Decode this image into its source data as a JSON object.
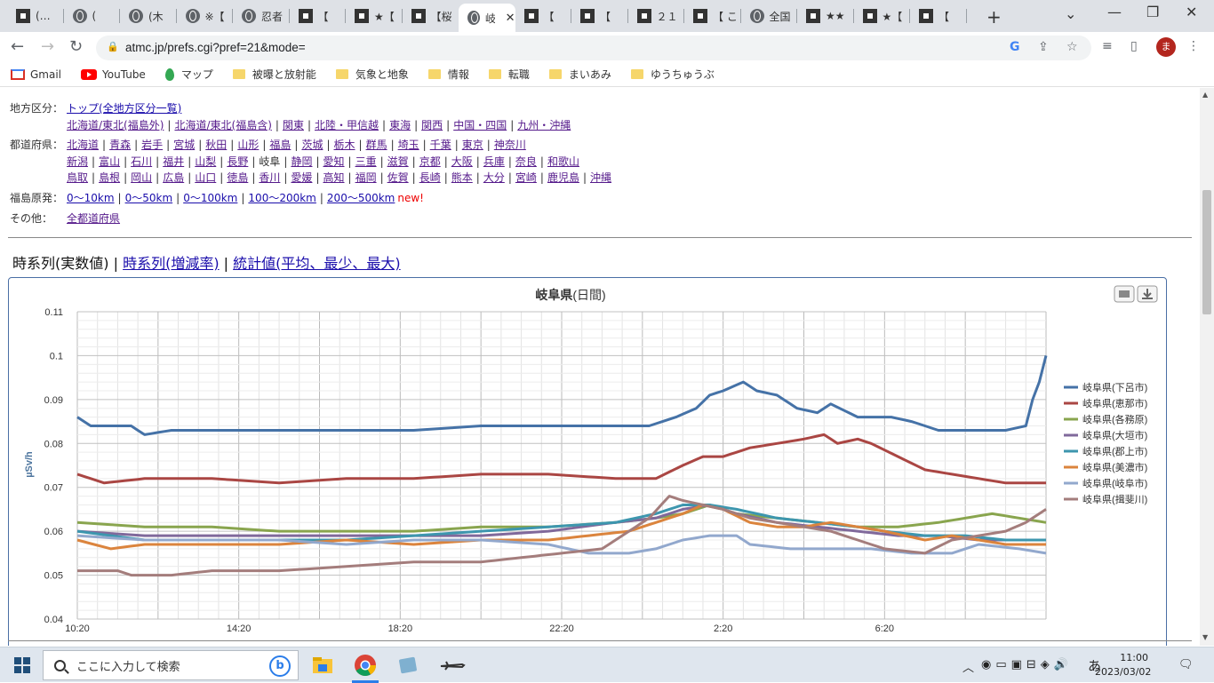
{
  "browser": {
    "tabs": [
      {
        "label": "(…",
        "icon": "dark"
      },
      {
        "label": "(",
        "icon": "globe"
      },
      {
        "label": "(木",
        "icon": "globe"
      },
      {
        "label": "※【",
        "icon": "globe"
      },
      {
        "label": "忍者",
        "icon": "globe"
      },
      {
        "label": "【 ",
        "icon": "dark"
      },
      {
        "label": "★【",
        "icon": "dark"
      },
      {
        "label": "【桜",
        "icon": "dark"
      },
      {
        "label": "岐",
        "icon": "globe",
        "active": true
      },
      {
        "label": "【",
        "icon": "dark"
      },
      {
        "label": "【",
        "icon": "dark"
      },
      {
        "label": "２１",
        "icon": "dark"
      },
      {
        "label": "【 こ",
        "icon": "dark"
      },
      {
        "label": "全国",
        "icon": "globe"
      },
      {
        "label": "★★",
        "icon": "dark"
      },
      {
        "label": "★【",
        "icon": "dark"
      },
      {
        "label": "【 ",
        "icon": "dark"
      }
    ],
    "url": "atmc.jp/prefs.cgi?pref=21&mode=",
    "avatar_letter": "ま",
    "bookmarks": [
      {
        "label": "Gmail",
        "icon": "gmail-icon"
      },
      {
        "label": "YouTube",
        "icon": "youtube-icon"
      },
      {
        "label": "マップ",
        "icon": "maps-icon"
      },
      {
        "label": "被曝と放射能",
        "icon": "folder-icon"
      },
      {
        "label": "気象と地象",
        "icon": "folder-icon"
      },
      {
        "label": "情報",
        "icon": "folder-icon"
      },
      {
        "label": "転職",
        "icon": "folder-icon"
      },
      {
        "label": "まいあみ",
        "icon": "folder-icon"
      },
      {
        "label": "ゆうちゅうぶ",
        "icon": "folder-icon"
      }
    ]
  },
  "nav": {
    "region_label": "地方区分：",
    "region_top": "トップ(全地方区分一覧)",
    "regions": [
      "北海道/東北(福島外)",
      "北海道/東北(福島含)",
      "関東",
      "北陸・甲信越",
      "東海",
      "関西",
      "中国・四国",
      "九州・沖縄"
    ],
    "pref_label": "都道府県：",
    "prefs_row1": [
      "北海道",
      "青森",
      "岩手",
      "宮城",
      "秋田",
      "山形",
      "福島",
      "茨城",
      "栃木",
      "群馬",
      "埼玉",
      "千葉",
      "東京",
      "神奈川"
    ],
    "prefs_row2": [
      "新潟",
      "富山",
      "石川",
      "福井",
      "山梨",
      "長野",
      "岐阜",
      "静岡",
      "愛知",
      "三重",
      "滋賀",
      "京都",
      "大阪",
      "兵庫",
      "奈良",
      "和歌山"
    ],
    "prefs_row3": [
      "鳥取",
      "島根",
      "岡山",
      "広島",
      "山口",
      "徳島",
      "香川",
      "愛媛",
      "高知",
      "福岡",
      "佐賀",
      "長崎",
      "熊本",
      "大分",
      "宮崎",
      "鹿児島",
      "沖縄"
    ],
    "current_pref": "岐阜",
    "fukushima_label": "福島原発：",
    "fukushima": [
      "0〜10km",
      "0〜50km",
      "0〜100km",
      "100〜200km",
      "200〜500km"
    ],
    "new_badge": "new!",
    "other_label": "その他：",
    "other_link": "全都道府県"
  },
  "modes": {
    "current": "時系列(実数値)",
    "link1": "時系列(増減率)",
    "link2": "統計値(平均、最少、最大)",
    "sep": "|"
  },
  "chart_data": {
    "type": "line",
    "title": "岐阜県",
    "subtitle": "(日間)",
    "ylabel": "µSv/h",
    "ylim": [
      0.04,
      0.11
    ],
    "yticks": [
      "0.04",
      "0.05",
      "0.06",
      "0.07",
      "0.08",
      "0.09",
      "0.1",
      "0.11"
    ],
    "xtick_labels": [
      "10:20",
      "14:20",
      "18:20",
      "22:20",
      "2:20",
      "6:20"
    ],
    "n_points": 145,
    "series": [
      {
        "name": "岐阜県(下呂市)",
        "color": "#4572a7",
        "knots": [
          [
            0,
            0.086
          ],
          [
            2,
            0.084
          ],
          [
            8,
            0.084
          ],
          [
            10,
            0.082
          ],
          [
            14,
            0.083
          ],
          [
            20,
            0.083
          ],
          [
            30,
            0.083
          ],
          [
            40,
            0.083
          ],
          [
            50,
            0.083
          ],
          [
            60,
            0.084
          ],
          [
            70,
            0.084
          ],
          [
            80,
            0.084
          ],
          [
            85,
            0.084
          ],
          [
            89,
            0.086
          ],
          [
            92,
            0.088
          ],
          [
            94,
            0.091
          ],
          [
            96,
            0.092
          ],
          [
            99,
            0.094
          ],
          [
            101,
            0.092
          ],
          [
            104,
            0.091
          ],
          [
            107,
            0.088
          ],
          [
            110,
            0.087
          ],
          [
            112,
            0.089
          ],
          [
            116,
            0.086
          ],
          [
            121,
            0.086
          ],
          [
            124,
            0.085
          ],
          [
            128,
            0.083
          ],
          [
            134,
            0.083
          ],
          [
            138,
            0.083
          ],
          [
            141,
            0.084
          ],
          [
            142,
            0.09
          ],
          [
            143,
            0.094
          ],
          [
            144,
            0.1
          ]
        ]
      },
      {
        "name": "岐阜県(恵那市)",
        "color": "#aa4643",
        "knots": [
          [
            0,
            0.073
          ],
          [
            4,
            0.071
          ],
          [
            10,
            0.072
          ],
          [
            20,
            0.072
          ],
          [
            30,
            0.071
          ],
          [
            40,
            0.072
          ],
          [
            50,
            0.072
          ],
          [
            60,
            0.073
          ],
          [
            70,
            0.073
          ],
          [
            80,
            0.072
          ],
          [
            86,
            0.072
          ],
          [
            90,
            0.075
          ],
          [
            93,
            0.077
          ],
          [
            96,
            0.077
          ],
          [
            100,
            0.079
          ],
          [
            104,
            0.08
          ],
          [
            108,
            0.081
          ],
          [
            111,
            0.082
          ],
          [
            113,
            0.08
          ],
          [
            116,
            0.081
          ],
          [
            118,
            0.08
          ],
          [
            122,
            0.077
          ],
          [
            126,
            0.074
          ],
          [
            130,
            0.073
          ],
          [
            134,
            0.072
          ],
          [
            138,
            0.071
          ],
          [
            141,
            0.071
          ],
          [
            144,
            0.071
          ]
        ]
      },
      {
        "name": "岐阜県(各務原)",
        "color": "#89a54e",
        "knots": [
          [
            0,
            0.062
          ],
          [
            10,
            0.061
          ],
          [
            20,
            0.061
          ],
          [
            30,
            0.06
          ],
          [
            40,
            0.06
          ],
          [
            50,
            0.06
          ],
          [
            60,
            0.061
          ],
          [
            70,
            0.061
          ],
          [
            80,
            0.062
          ],
          [
            86,
            0.063
          ],
          [
            90,
            0.064
          ],
          [
            94,
            0.066
          ],
          [
            98,
            0.064
          ],
          [
            104,
            0.063
          ],
          [
            110,
            0.062
          ],
          [
            116,
            0.061
          ],
          [
            122,
            0.061
          ],
          [
            128,
            0.062
          ],
          [
            132,
            0.063
          ],
          [
            136,
            0.064
          ],
          [
            140,
            0.063
          ],
          [
            144,
            0.062
          ]
        ]
      },
      {
        "name": "岐阜県(大垣市)",
        "color": "#80699b",
        "knots": [
          [
            0,
            0.06
          ],
          [
            10,
            0.059
          ],
          [
            20,
            0.059
          ],
          [
            30,
            0.059
          ],
          [
            40,
            0.059
          ],
          [
            50,
            0.059
          ],
          [
            60,
            0.059
          ],
          [
            70,
            0.06
          ],
          [
            80,
            0.062
          ],
          [
            86,
            0.063
          ],
          [
            90,
            0.065
          ],
          [
            94,
            0.066
          ],
          [
            98,
            0.064
          ],
          [
            104,
            0.062
          ],
          [
            110,
            0.061
          ],
          [
            116,
            0.06
          ],
          [
            122,
            0.059
          ],
          [
            128,
            0.059
          ],
          [
            134,
            0.058
          ],
          [
            140,
            0.058
          ],
          [
            144,
            0.058
          ]
        ]
      },
      {
        "name": "岐阜県(郡上市)",
        "color": "#3d96ae",
        "knots": [
          [
            0,
            0.06
          ],
          [
            10,
            0.058
          ],
          [
            20,
            0.058
          ],
          [
            30,
            0.058
          ],
          [
            40,
            0.058
          ],
          [
            50,
            0.059
          ],
          [
            60,
            0.06
          ],
          [
            70,
            0.061
          ],
          [
            80,
            0.062
          ],
          [
            86,
            0.064
          ],
          [
            90,
            0.066
          ],
          [
            94,
            0.066
          ],
          [
            98,
            0.065
          ],
          [
            104,
            0.063
          ],
          [
            110,
            0.062
          ],
          [
            116,
            0.061
          ],
          [
            120,
            0.06
          ],
          [
            126,
            0.059
          ],
          [
            132,
            0.059
          ],
          [
            138,
            0.058
          ],
          [
            144,
            0.058
          ]
        ]
      },
      {
        "name": "岐阜県(美濃市)",
        "color": "#db843d",
        "knots": [
          [
            0,
            0.058
          ],
          [
            5,
            0.056
          ],
          [
            10,
            0.057
          ],
          [
            20,
            0.057
          ],
          [
            30,
            0.057
          ],
          [
            40,
            0.058
          ],
          [
            50,
            0.057
          ],
          [
            60,
            0.058
          ],
          [
            70,
            0.058
          ],
          [
            76,
            0.059
          ],
          [
            82,
            0.06
          ],
          [
            86,
            0.062
          ],
          [
            90,
            0.064
          ],
          [
            93,
            0.066
          ],
          [
            96,
            0.065
          ],
          [
            100,
            0.062
          ],
          [
            104,
            0.061
          ],
          [
            108,
            0.061
          ],
          [
            112,
            0.062
          ],
          [
            116,
            0.061
          ],
          [
            120,
            0.06
          ],
          [
            126,
            0.058
          ],
          [
            130,
            0.059
          ],
          [
            134,
            0.058
          ],
          [
            138,
            0.057
          ],
          [
            142,
            0.057
          ],
          [
            144,
            0.057
          ]
        ]
      },
      {
        "name": "岐阜県(岐阜市)",
        "color": "#92a8cd",
        "knots": [
          [
            0,
            0.059
          ],
          [
            10,
            0.058
          ],
          [
            20,
            0.058
          ],
          [
            30,
            0.058
          ],
          [
            40,
            0.057
          ],
          [
            50,
            0.058
          ],
          [
            60,
            0.058
          ],
          [
            70,
            0.057
          ],
          [
            76,
            0.055
          ],
          [
            82,
            0.055
          ],
          [
            86,
            0.056
          ],
          [
            90,
            0.058
          ],
          [
            94,
            0.059
          ],
          [
            98,
            0.059
          ],
          [
            100,
            0.057
          ],
          [
            106,
            0.056
          ],
          [
            112,
            0.056
          ],
          [
            118,
            0.056
          ],
          [
            124,
            0.055
          ],
          [
            130,
            0.055
          ],
          [
            134,
            0.057
          ],
          [
            140,
            0.056
          ],
          [
            144,
            0.055
          ]
        ]
      },
      {
        "name": "岐阜県(揖斐川)",
        "color": "#a47d7c",
        "knots": [
          [
            0,
            0.051
          ],
          [
            6,
            0.051
          ],
          [
            8,
            0.05
          ],
          [
            14,
            0.05
          ],
          [
            20,
            0.051
          ],
          [
            30,
            0.051
          ],
          [
            40,
            0.052
          ],
          [
            50,
            0.053
          ],
          [
            60,
            0.053
          ],
          [
            66,
            0.054
          ],
          [
            72,
            0.055
          ],
          [
            78,
            0.056
          ],
          [
            82,
            0.06
          ],
          [
            85,
            0.063
          ],
          [
            88,
            0.068
          ],
          [
            90,
            0.067
          ],
          [
            93,
            0.066
          ],
          [
            96,
            0.065
          ],
          [
            100,
            0.063
          ],
          [
            104,
            0.062
          ],
          [
            108,
            0.061
          ],
          [
            112,
            0.06
          ],
          [
            116,
            0.058
          ],
          [
            120,
            0.056
          ],
          [
            126,
            0.055
          ],
          [
            130,
            0.058
          ],
          [
            134,
            0.059
          ],
          [
            138,
            0.06
          ],
          [
            141,
            0.062
          ],
          [
            144,
            0.065
          ]
        ]
      }
    ]
  },
  "taskbar": {
    "search_placeholder": "ここに入力して検索",
    "time": "11:00",
    "date": "2023/03/02",
    "ime": "あ"
  }
}
